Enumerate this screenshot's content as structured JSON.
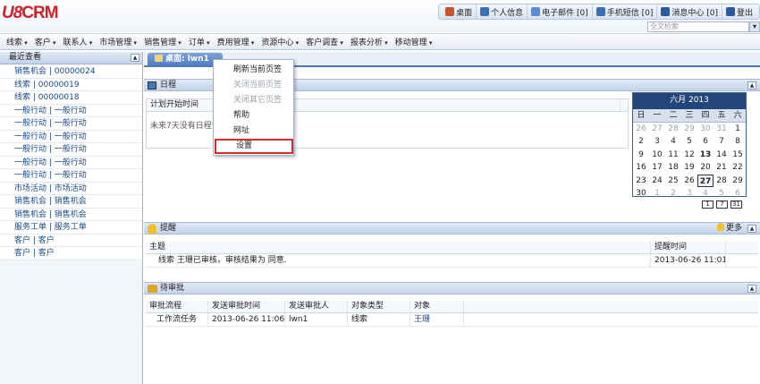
{
  "app": {
    "logo_u8": "U8",
    "logo_crm": "CRM"
  },
  "toplinks": [
    {
      "icon": "home-icon",
      "label": "桌面",
      "color": "#c8552a"
    },
    {
      "icon": "person-icon",
      "label": "个人信息",
      "color": "#3d6fb5"
    },
    {
      "icon": "mail-icon",
      "label": "电子邮件 [0]",
      "color": "#5a8ed0"
    },
    {
      "icon": "phone-icon",
      "label": "手机短信 [0]",
      "color": "#3d6fb5"
    },
    {
      "icon": "message-icon",
      "label": "消息中心 [0]",
      "color": "#2d5a9a"
    },
    {
      "icon": "exit-icon",
      "label": "登出",
      "color": "#2d5a9a"
    }
  ],
  "search": {
    "placeholder": "全文检索"
  },
  "menu": [
    "线索",
    "客户",
    "联系人",
    "市场管理",
    "销售管理",
    "订单",
    "费用管理",
    "资源中心",
    "客户调查",
    "报表分析",
    "移动管理"
  ],
  "left": {
    "title": "最近查看",
    "items": [
      "销售机会 | 00000024",
      "线索 | 00000019",
      "线索 | 00000018",
      "一般行动 | 一般行动",
      "一般行动 | 一般行动",
      "一般行动 | 一般行动",
      "一般行动 | 一般行动",
      "一般行动 | 一般行动",
      "一般行动 | 一般行动",
      "市场活动 | 市场活动",
      "销售机会 | 销售机会",
      "销售机会 | 销售机会",
      "服务工单 | 服务工单",
      "客户 | 客户",
      "客户 | 客户"
    ]
  },
  "tab": {
    "label": "桌面: lwn1"
  },
  "schedule": {
    "title": "日程",
    "col_header": "计划开始时间",
    "empty": "未来7天没有日程安排"
  },
  "calendar": {
    "title": "六月 2013",
    "weekdays": [
      "日",
      "一",
      "二",
      "三",
      "四",
      "五",
      "六"
    ],
    "days": [
      [
        "26",
        1
      ],
      [
        "27",
        1
      ],
      [
        "28",
        1
      ],
      [
        "29",
        1
      ],
      [
        "30",
        1
      ],
      [
        "31",
        1
      ],
      [
        "1",
        0
      ],
      [
        "2",
        0
      ],
      [
        "3",
        0
      ],
      [
        "4",
        0
      ],
      [
        "5",
        0
      ],
      [
        "6",
        0
      ],
      [
        "7",
        0
      ],
      [
        "8",
        0
      ],
      [
        "9",
        0
      ],
      [
        "10",
        0
      ],
      [
        "11",
        0
      ],
      [
        "12",
        0
      ],
      [
        "13",
        2
      ],
      [
        "14",
        0
      ],
      [
        "15",
        0
      ],
      [
        "16",
        0
      ],
      [
        "17",
        0
      ],
      [
        "18",
        0
      ],
      [
        "19",
        0
      ],
      [
        "20",
        0
      ],
      [
        "21",
        0
      ],
      [
        "22",
        0
      ],
      [
        "23",
        0
      ],
      [
        "24",
        0
      ],
      [
        "25",
        0
      ],
      [
        "26",
        0
      ],
      [
        "27",
        3
      ],
      [
        "28",
        0
      ],
      [
        "29",
        0
      ],
      [
        "30",
        0
      ],
      [
        "1",
        1
      ],
      [
        "2",
        1
      ],
      [
        "3",
        1
      ],
      [
        "4",
        1
      ],
      [
        "5",
        1
      ],
      [
        "6",
        1
      ]
    ],
    "view_buttons": [
      "1",
      "7",
      "31"
    ]
  },
  "reminder": {
    "title": "提醒",
    "more": "更多",
    "col_subject": "主题",
    "col_time": "提醒时间",
    "rows": [
      {
        "subject": "线索 王珊已审核，审核结果为 同意.",
        "time": "2013-06-26 11:01:23"
      }
    ]
  },
  "approval": {
    "title": "待审批",
    "cols": [
      "审批流程",
      "发送审批时间",
      "发送审批人",
      "对象类型",
      "对象"
    ],
    "rows": [
      [
        "工作流任务",
        "2013-06-26 11:06:07",
        "lwn1",
        "线索",
        "王珊"
      ]
    ]
  },
  "context_menu": [
    {
      "label": "刷新当前页签",
      "disabled": false
    },
    {
      "label": "关闭当前页签",
      "disabled": true
    },
    {
      "label": "关闭其它页签",
      "disabled": true
    },
    {
      "label": "帮助",
      "disabled": false
    },
    {
      "label": "网址",
      "disabled": false
    },
    {
      "label": "设置",
      "disabled": false,
      "highlight": true
    }
  ]
}
